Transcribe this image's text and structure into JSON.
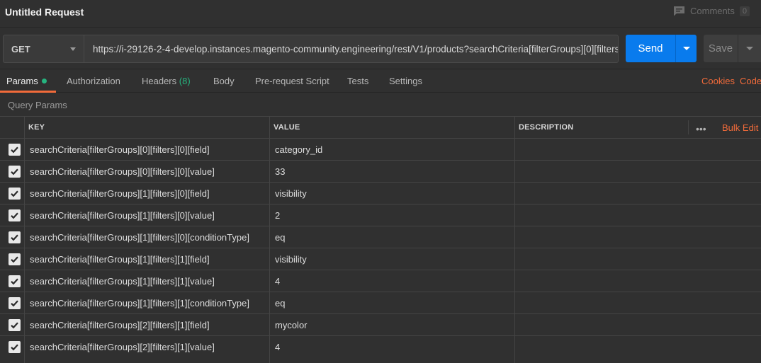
{
  "title": "Untitled Request",
  "comments": {
    "label": "Comments",
    "count": "0"
  },
  "request": {
    "method": "GET",
    "url": "https://i-29126-2-4-develop.instances.magento-community.engineering/rest/V1/products?searchCriteria[filterGroups][0][filters][0 ...",
    "send_label": "Send",
    "save_label": "Save"
  },
  "tabs": {
    "params": "Params",
    "authorization": "Authorization",
    "headers": "Headers",
    "headers_count": "(8)",
    "body": "Body",
    "prerequest": "Pre-request Script",
    "tests": "Tests",
    "settings": "Settings",
    "cookies": "Cookies",
    "code": "Code"
  },
  "query_params": {
    "label": "Query Params",
    "headers": {
      "key": "KEY",
      "value": "VALUE",
      "description": "DESCRIPTION",
      "more": "•••",
      "bulk_edit": "Bulk Edit"
    },
    "rows": [
      {
        "key": "searchCriteria[filterGroups][0][filters][0][field]",
        "value": "category_id"
      },
      {
        "key": "searchCriteria[filterGroups][0][filters][0][value]",
        "value": "33"
      },
      {
        "key": "searchCriteria[filterGroups][1][filters][0][field]",
        "value": "visibility"
      },
      {
        "key": "searchCriteria[filterGroups][1][filters][0][value]",
        "value": "2"
      },
      {
        "key": "searchCriteria[filterGroups][1][filters][0][conditionType]",
        "value": "eq"
      },
      {
        "key": "searchCriteria[filterGroups][1][filters][1][field]",
        "value": "visibility"
      },
      {
        "key": "searchCriteria[filterGroups][1][filters][1][value]",
        "value": "4"
      },
      {
        "key": "searchCriteria[filterGroups][1][filters][1][conditionType]",
        "value": "eq"
      },
      {
        "key": "searchCriteria[filterGroups][2][filters][1][field]",
        "value": "mycolor"
      },
      {
        "key": "searchCriteria[filterGroups][2][filters][1][value]",
        "value": "4"
      }
    ]
  },
  "colors": {
    "accent": "#f26b3a",
    "send": "#097bed",
    "status_dot": "#26b47f",
    "background": "#303030"
  }
}
